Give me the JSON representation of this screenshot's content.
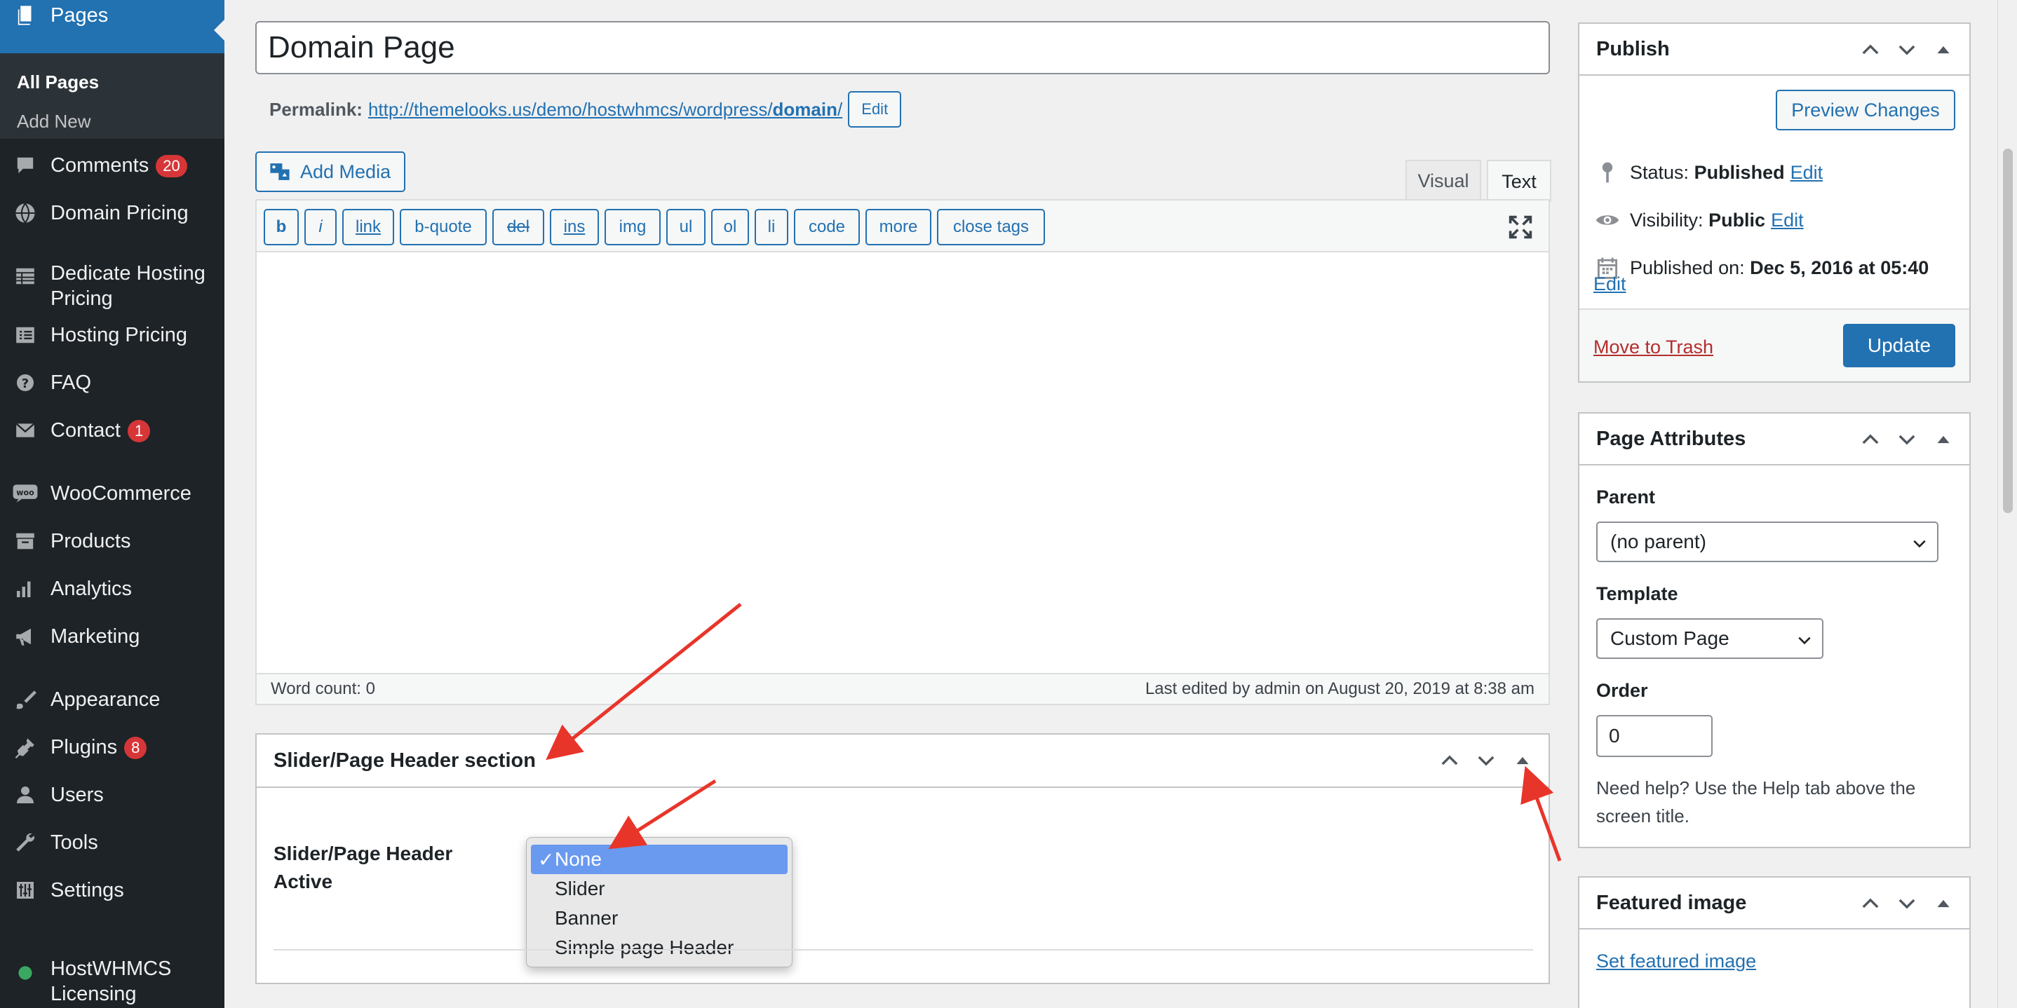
{
  "sidebar": {
    "current": "Pages",
    "submenu": [
      "All Pages",
      "Add New"
    ],
    "items": [
      {
        "label": "Comments",
        "badge": "20",
        "icon": "comments-icon"
      },
      {
        "label": "Domain Pricing",
        "icon": "globe-icon"
      },
      {
        "label": "Dedicate Hosting",
        "label2": "Pricing",
        "icon": "table-icon"
      },
      {
        "label": "Hosting Pricing",
        "icon": "list-icon"
      },
      {
        "label": "FAQ",
        "icon": "help-icon"
      },
      {
        "label": "Contact",
        "badge": "1",
        "icon": "email-icon"
      },
      {
        "label": "WooCommerce",
        "icon": "woo-icon"
      },
      {
        "label": "Products",
        "icon": "archive-icon"
      },
      {
        "label": "Analytics",
        "icon": "chart-bar-icon"
      },
      {
        "label": "Marketing",
        "icon": "megaphone-icon"
      },
      {
        "label": "Appearance",
        "icon": "brush-icon"
      },
      {
        "label": "Plugins",
        "badge": "8",
        "icon": "plugin-icon"
      },
      {
        "label": "Users",
        "icon": "user-icon"
      },
      {
        "label": "Tools",
        "icon": "wrench-icon"
      },
      {
        "label": "Settings",
        "icon": "settings-icon"
      },
      {
        "label": "HostWHMCS",
        "label2": "Licensing",
        "icon": "dot-icon"
      }
    ]
  },
  "editor": {
    "title": "Domain Page",
    "permalink_label": "Permalink:",
    "permalink_base": "http://themelooks.us/demo/hostwhmcs/wordpress/",
    "permalink_slug": "domain",
    "permalink_end": "/",
    "edit_label": "Edit",
    "add_media": "Add Media",
    "tab_visual": "Visual",
    "tab_text": "Text",
    "buttons": [
      "b",
      "i",
      "link",
      "b-quote",
      "del",
      "ins",
      "img",
      "ul",
      "ol",
      "li",
      "code",
      "more",
      "close tags"
    ],
    "word_count": "Word count: 0",
    "last_edited": "Last edited by admin on August 20, 2019 at 8:38 am"
  },
  "slider_section": {
    "title": "Slider/Page Header section",
    "field_label": "Slider/Page Header Active",
    "options": [
      "None",
      "Slider",
      "Banner",
      "Simple page Header"
    ],
    "selected_check": "✓"
  },
  "publish": {
    "title": "Publish",
    "preview": "Preview Changes",
    "status_label": "Status:",
    "status_value": "Published",
    "visibility_label": "Visibility:",
    "visibility_value": "Public",
    "published_label": "Published on:",
    "published_value": "Dec 5, 2016 at 05:40",
    "edit": "Edit",
    "trash": "Move to Trash",
    "update": "Update"
  },
  "page_attributes": {
    "title": "Page Attributes",
    "parent_label": "Parent",
    "parent_value": "(no parent)",
    "template_label": "Template",
    "template_value": "Custom Page",
    "order_label": "Order",
    "order_value": "0",
    "help": "Need help? Use the Help tab above the screen title."
  },
  "featured": {
    "title": "Featured image",
    "link": "Set featured image"
  },
  "colors": {
    "sidebar_bg": "#1d2327",
    "accent": "#2271b1",
    "badge": "#d63638",
    "annotation": "#e8352a"
  }
}
